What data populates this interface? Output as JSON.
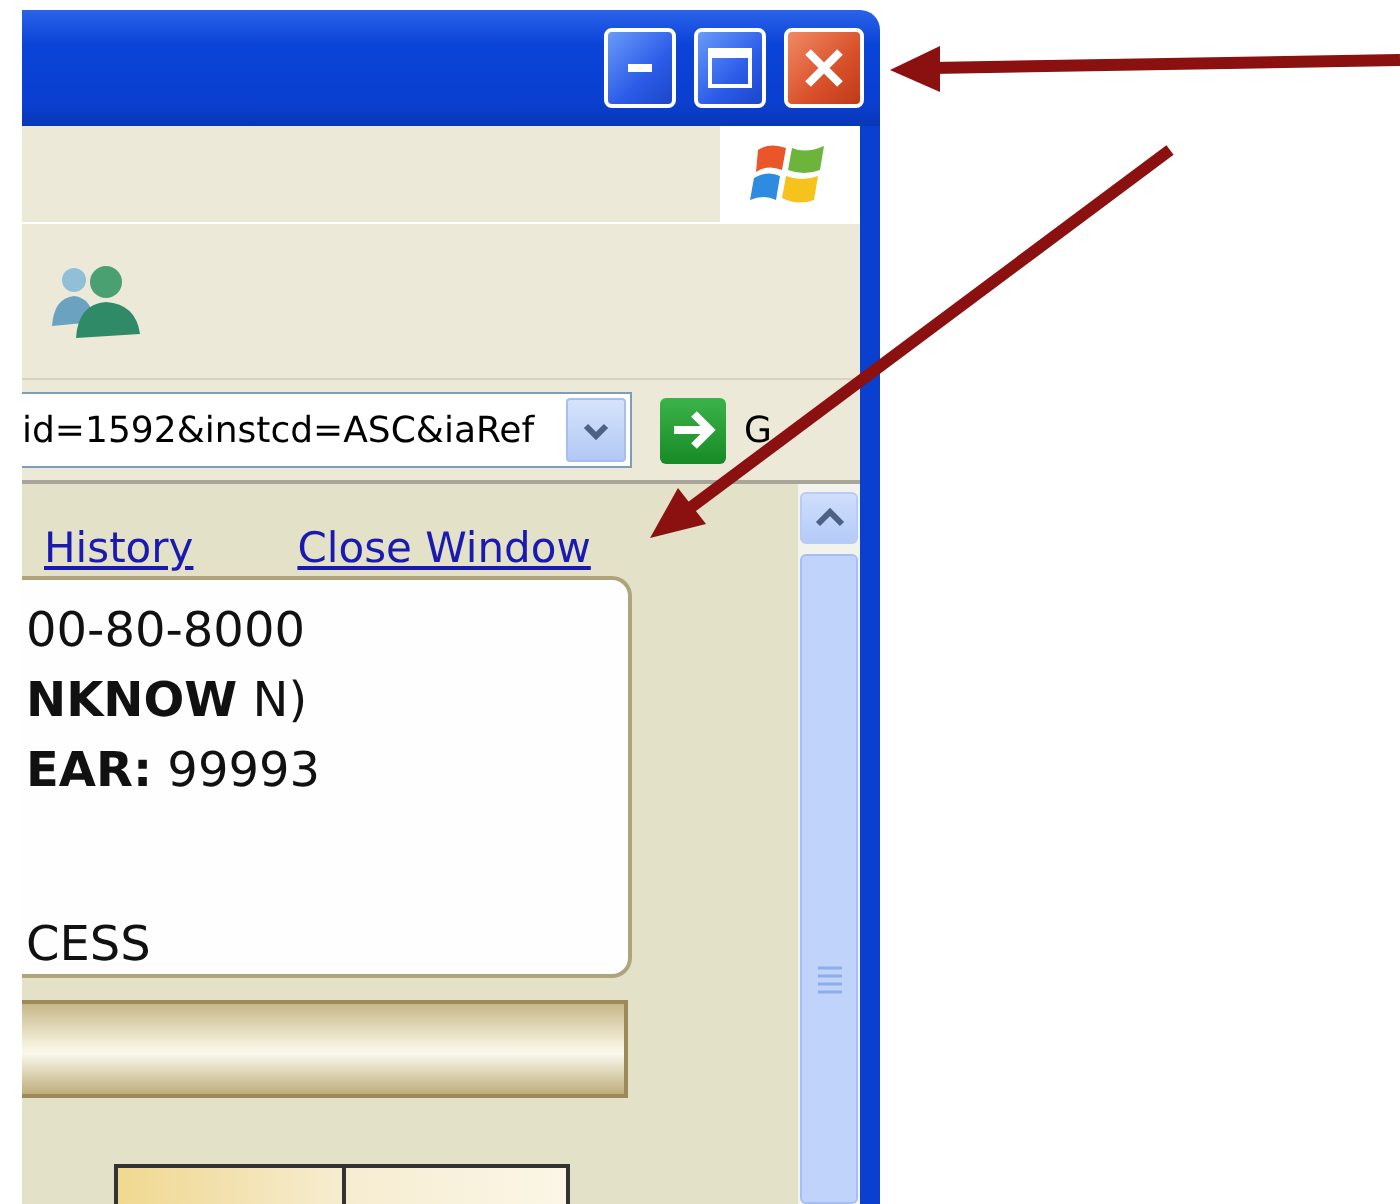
{
  "address_bar": {
    "value": "id=1592&instcd=ASC&iaRef"
  },
  "go_button": {
    "label": "G"
  },
  "links": [
    {
      "label": "History"
    },
    {
      "label": "Close Window"
    }
  ],
  "record_card": {
    "lines": [
      {
        "text": "00-80-8000",
        "kind": "line"
      },
      {
        "text": "**NKNOW** N)",
        "kind": "line"
      },
      {
        "text": "**EAR:** 99993",
        "kind": "line"
      },
      {
        "text": "CESS",
        "kind": "spaced"
      }
    ]
  }
}
